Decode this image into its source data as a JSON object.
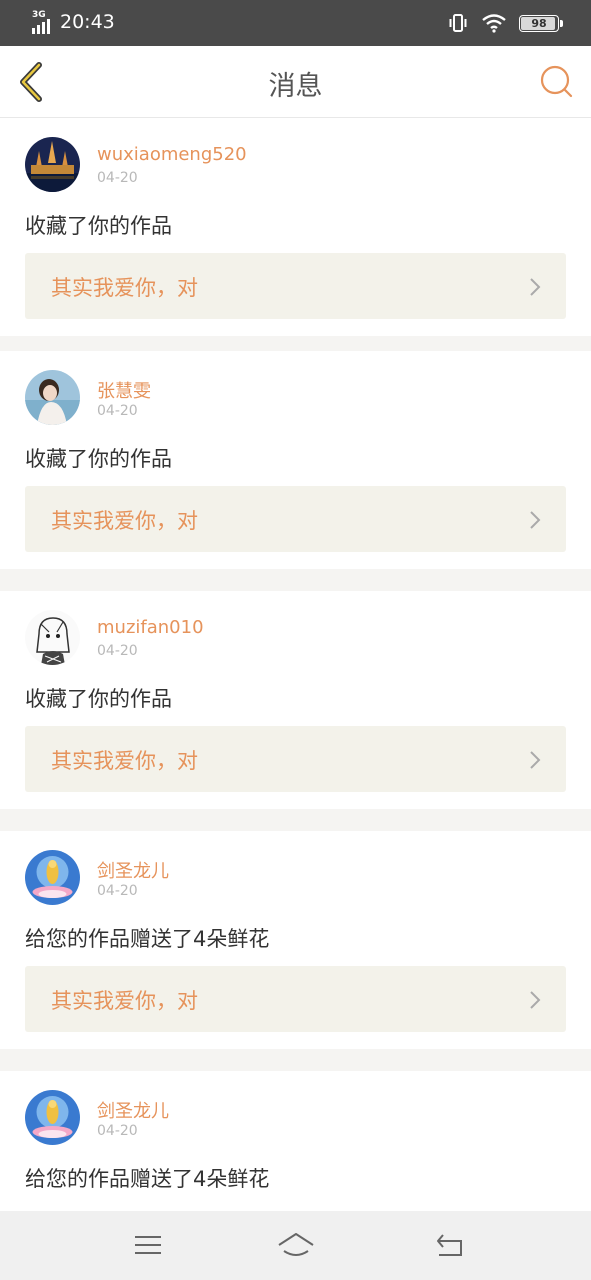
{
  "status_bar": {
    "network": "3G",
    "time": "20:43",
    "battery": "98",
    "battery_level": 0.98
  },
  "header": {
    "title": "消息"
  },
  "colors": {
    "accent": "#e6935b",
    "card_link_bg": "#f3f2ea",
    "divider": "#f5f4f2"
  },
  "messages": [
    {
      "username": "wuxiaomeng520",
      "date": "04-20",
      "action": "收藏了你的作品",
      "work_title": "其实我爱你，对",
      "avatar": "temple-night-photo"
    },
    {
      "username": "张慧雯",
      "date": "04-20",
      "action": "收藏了你的作品",
      "work_title": "其实我爱你，对",
      "avatar": "girl-portrait-photo"
    },
    {
      "username": "muzifan010",
      "date": "04-20",
      "action": "收藏了你的作品",
      "work_title": "其实我爱你，对",
      "avatar": "sketch-girl-drawing"
    },
    {
      "username": "剑圣龙儿",
      "date": "04-20",
      "action": "给您的作品赠送了4朵鲜花",
      "work_title": "其实我爱你，对",
      "avatar": "buddha-lotus-image"
    },
    {
      "username": "剑圣龙儿",
      "date": "04-20",
      "action": "给您的作品赠送了4朵鲜花",
      "work_title": "",
      "avatar": "buddha-lotus-image"
    }
  ],
  "nav_bar": {
    "icons": [
      "menu-icon",
      "home-icon",
      "back-icon"
    ]
  }
}
